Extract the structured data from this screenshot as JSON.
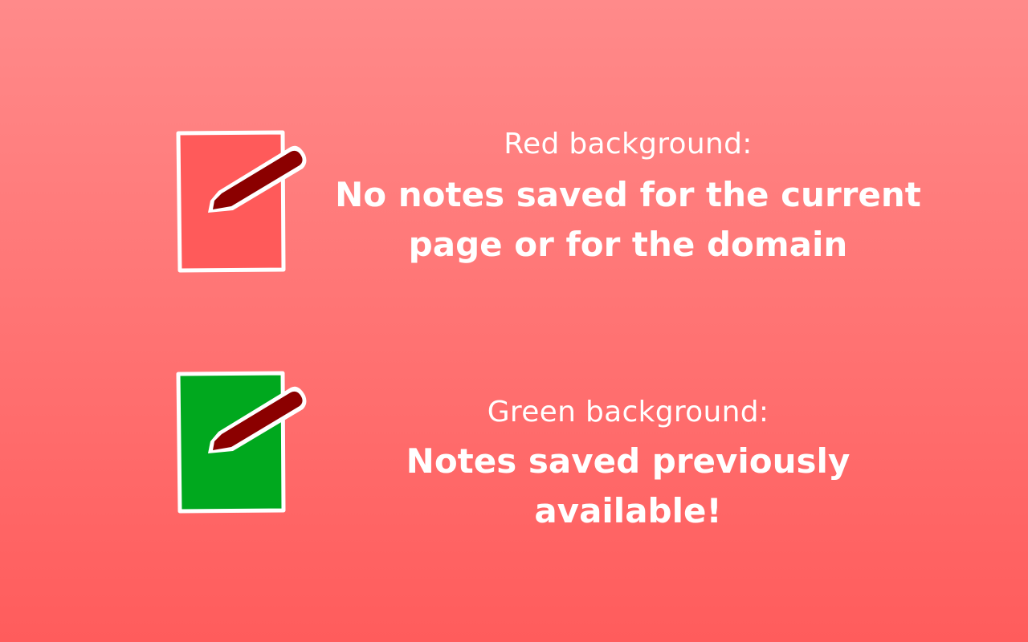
{
  "items": [
    {
      "icon": "note-pencil-icon",
      "icon_bg_color": "#ff5a5a",
      "pencil_color": "#8b0000",
      "caption": "Red background:",
      "headline_line1": "No notes saved for the current",
      "headline_line2": "page or for the domain"
    },
    {
      "icon": "note-pencil-icon",
      "icon_bg_color": "#00a81e",
      "pencil_color": "#8b0000",
      "caption": "Green background:",
      "headline_line1": "Notes saved previously available!"
    }
  ]
}
